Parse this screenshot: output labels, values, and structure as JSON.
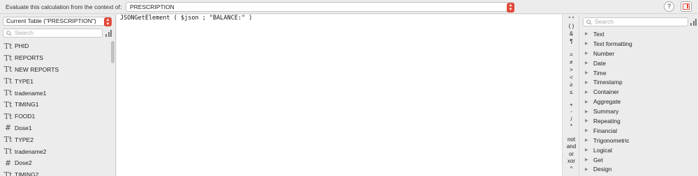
{
  "context": {
    "label": "Evaluate this calculation from the context of:",
    "selected": "PRESCRIPTION"
  },
  "left": {
    "table_selected": "Current Table (\"PRESCRIPTION\")",
    "search_placeholder": "Search",
    "fields": [
      {
        "icon": "text",
        "glyph": "Tt",
        "name": "PHID"
      },
      {
        "icon": "text",
        "glyph": "Tt",
        "name": "REPORTS"
      },
      {
        "icon": "text",
        "glyph": "Tt",
        "name": "NEW REPORTS"
      },
      {
        "icon": "text",
        "glyph": "Tt",
        "name": "TYPE1"
      },
      {
        "icon": "text",
        "glyph": "Tt",
        "name": "tradename1"
      },
      {
        "icon": "text",
        "glyph": "Tt",
        "name": "TIMING1"
      },
      {
        "icon": "text",
        "glyph": "Tt",
        "name": "FOOD1"
      },
      {
        "icon": "number",
        "glyph": "#",
        "name": "Dose1"
      },
      {
        "icon": "text",
        "glyph": "Tt",
        "name": "TYPE2"
      },
      {
        "icon": "text",
        "glyph": "Tt",
        "name": "tradename2"
      },
      {
        "icon": "number",
        "glyph": "#",
        "name": "Dose2"
      },
      {
        "icon": "text",
        "glyph": "Tt",
        "name": "TIMING2"
      }
    ]
  },
  "editor": {
    "formula": "JSONGetElement ( $json ; \"BALANCE:\" )"
  },
  "operators": [
    "\" \"",
    "( )",
    "&",
    "¶",
    "=",
    "≠",
    ">",
    "<",
    "≥",
    "≤",
    "+",
    "-",
    "/",
    "*",
    "not",
    "and",
    "or",
    "xor",
    "^"
  ],
  "functions": {
    "search_placeholder": "Search",
    "categories": [
      "Text",
      "Text formatting",
      "Number",
      "Date",
      "Time",
      "Timestamp",
      "Container",
      "Aggregate",
      "Summary",
      "Repeating",
      "Financial",
      "Trigonometric",
      "Logical",
      "Get",
      "Design"
    ]
  },
  "colors": {
    "accent": "#e24a3a"
  }
}
